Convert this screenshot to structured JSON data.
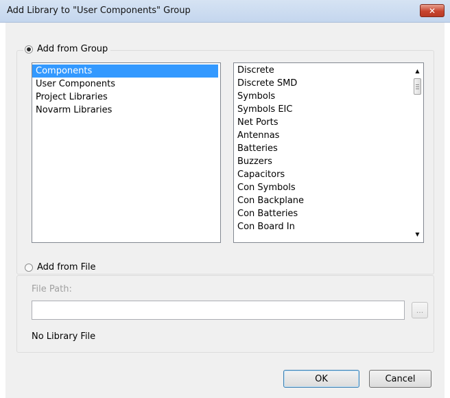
{
  "window": {
    "title": "Add Library to \"User Components\" Group",
    "close_glyph": "✕"
  },
  "group_section": {
    "radio_label": "Add from Group",
    "selected": true,
    "groups": [
      {
        "label": "Components",
        "selected": true
      },
      {
        "label": "User Components",
        "selected": false
      },
      {
        "label": "Project Libraries",
        "selected": false
      },
      {
        "label": "Novarm Libraries",
        "selected": false
      }
    ],
    "libraries": [
      "Discrete",
      "Discrete SMD",
      "Symbols",
      "Symbols EIC",
      "Net Ports",
      "Antennas",
      "Batteries",
      "Buzzers",
      "Capacitors",
      "Con Symbols",
      "Con Backplane",
      "Con Batteries",
      "Con Board In"
    ]
  },
  "file_section": {
    "radio_label": "Add from File",
    "selected": false,
    "path_label": "File Path:",
    "path_value": "",
    "browse_label": "...",
    "status": "No Library File"
  },
  "buttons": {
    "ok": "OK",
    "cancel": "Cancel"
  }
}
